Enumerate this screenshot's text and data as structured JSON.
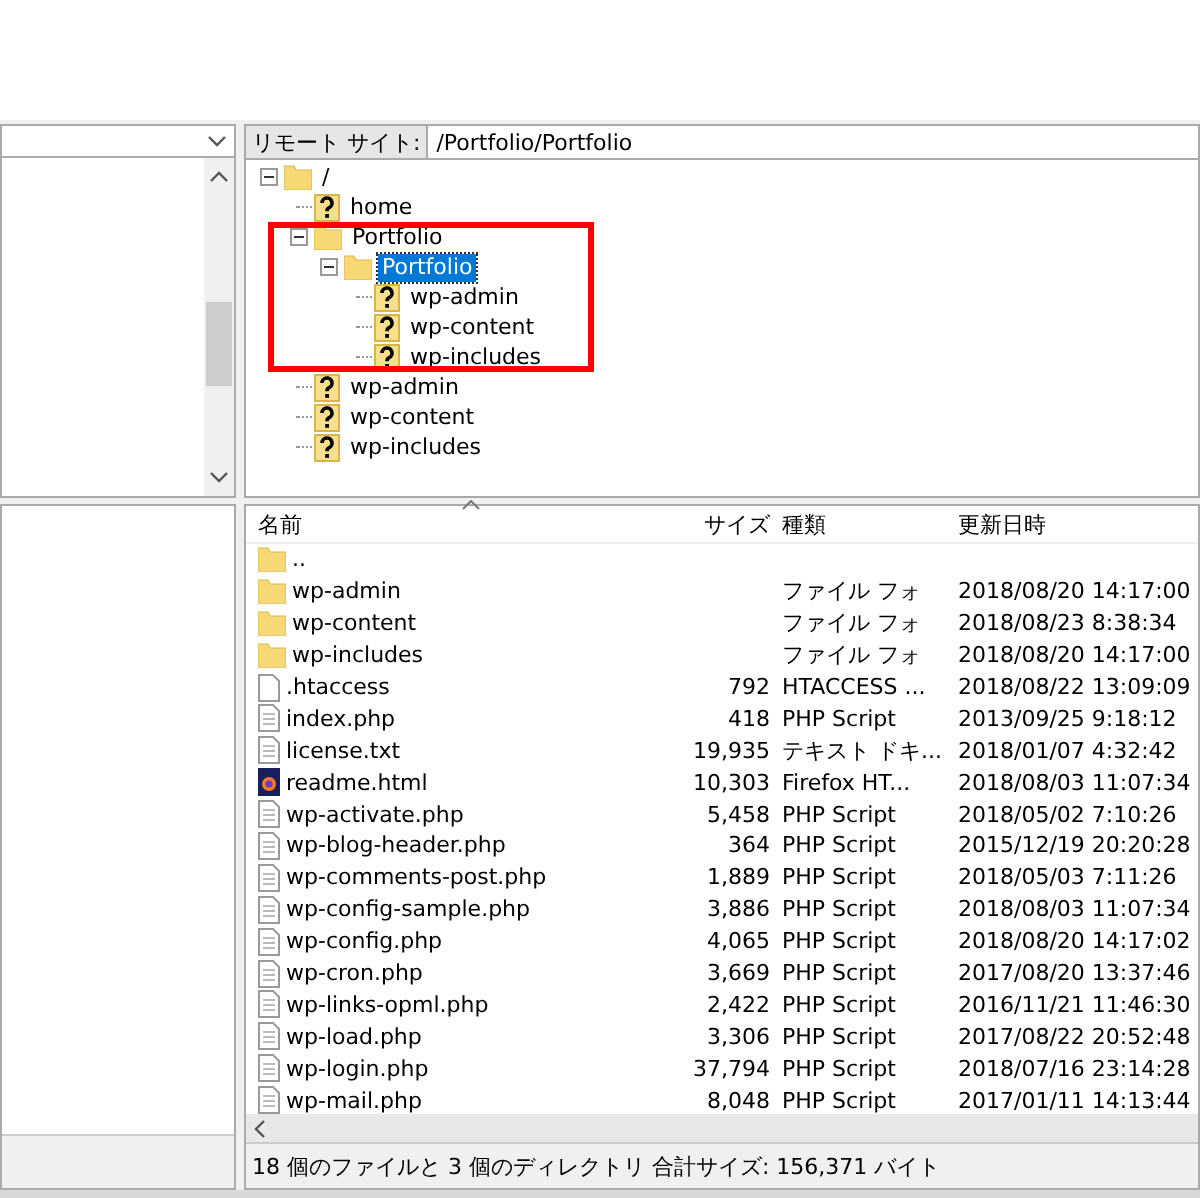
{
  "remote_site": {
    "label": "リモート サイト:",
    "path": "/Portfolio/Portfolio"
  },
  "tree": [
    {
      "name": "/",
      "kind": "folder",
      "expanded": true,
      "selected": false,
      "children": [
        {
          "name": "home",
          "kind": "unknown",
          "selected": false
        },
        {
          "name": "Portfolio",
          "kind": "folder",
          "expanded": true,
          "selected": false,
          "children": [
            {
              "name": "Portfolio",
              "kind": "folder",
              "expanded": true,
              "selected": true,
              "children": [
                {
                  "name": "wp-admin",
                  "kind": "unknown",
                  "selected": false
                },
                {
                  "name": "wp-content",
                  "kind": "unknown",
                  "selected": false
                },
                {
                  "name": "wp-includes",
                  "kind": "unknown",
                  "selected": false
                }
              ]
            }
          ]
        },
        {
          "name": "wp-admin",
          "kind": "unknown",
          "selected": false
        },
        {
          "name": "wp-content",
          "kind": "unknown",
          "selected": false
        },
        {
          "name": "wp-includes",
          "kind": "unknown",
          "selected": false
        }
      ]
    }
  ],
  "annotation": {
    "kind": "rectangle"
  },
  "file_list": {
    "columns": [
      "名前",
      "サイズ",
      "種類",
      "更新日時"
    ],
    "rows": [
      {
        "kind": "folder",
        "name": "..",
        "size": "",
        "type": "",
        "modified": ""
      },
      {
        "kind": "folder",
        "name": "wp-admin",
        "size": "",
        "type": "ファイル フォ",
        "modified": "2018/08/20 14:17:00"
      },
      {
        "kind": "folder",
        "name": "wp-content",
        "size": "",
        "type": "ファイル フォ",
        "modified": "2018/08/23 8:38:34"
      },
      {
        "kind": "folder",
        "name": "wp-includes",
        "size": "",
        "type": "ファイル フォ",
        "modified": "2018/08/20 14:17:00"
      },
      {
        "kind": "blank",
        "name": ".htaccess",
        "size": "792",
        "type": "HTACCESS ...",
        "modified": "2018/08/22 13:09:09"
      },
      {
        "kind": "file",
        "name": "index.php",
        "size": "418",
        "type": "PHP Script",
        "modified": "2013/09/25 9:18:12"
      },
      {
        "kind": "file",
        "name": "license.txt",
        "size": "19,935",
        "type": "テキスト ドキ...",
        "modified": "2018/01/07 4:32:42"
      },
      {
        "kind": "html",
        "name": "readme.html",
        "size": "10,303",
        "type": "Firefox HT...",
        "modified": "2018/08/03 11:07:34"
      },
      {
        "kind": "file",
        "name": "wp-activate.php",
        "size": "5,458",
        "type": "PHP Script",
        "modified": "2018/05/02 7:10:26"
      },
      {
        "kind": "file",
        "name": "wp-blog-header.php",
        "size": "364",
        "type": "PHP Script",
        "modified": "2015/12/19 20:20:28"
      },
      {
        "kind": "file",
        "name": "wp-comments-post.php",
        "size": "1,889",
        "type": "PHP Script",
        "modified": "2018/05/03 7:11:26"
      },
      {
        "kind": "file",
        "name": "wp-config-sample.php",
        "size": "3,886",
        "type": "PHP Script",
        "modified": "2018/08/03 11:07:34"
      },
      {
        "kind": "file",
        "name": "wp-config.php",
        "size": "4,065",
        "type": "PHP Script",
        "modified": "2018/08/20 14:17:02"
      },
      {
        "kind": "file",
        "name": "wp-cron.php",
        "size": "3,669",
        "type": "PHP Script",
        "modified": "2017/08/20 13:37:46"
      },
      {
        "kind": "file",
        "name": "wp-links-opml.php",
        "size": "2,422",
        "type": "PHP Script",
        "modified": "2016/11/21 11:46:30"
      },
      {
        "kind": "file",
        "name": "wp-load.php",
        "size": "3,306",
        "type": "PHP Script",
        "modified": "2017/08/22 20:52:48"
      },
      {
        "kind": "file",
        "name": "wp-login.php",
        "size": "37,794",
        "type": "PHP Script",
        "modified": "2018/07/16 23:14:28"
      },
      {
        "kind": "file",
        "name": "wp-mail.php",
        "size": "8,048",
        "type": "PHP Script",
        "modified": "2017/01/11 14:13:44"
      }
    ]
  },
  "status_bar": "18 個のファイルと 3 個のディレクトリ 合計サイズ: 156,371 バイト"
}
